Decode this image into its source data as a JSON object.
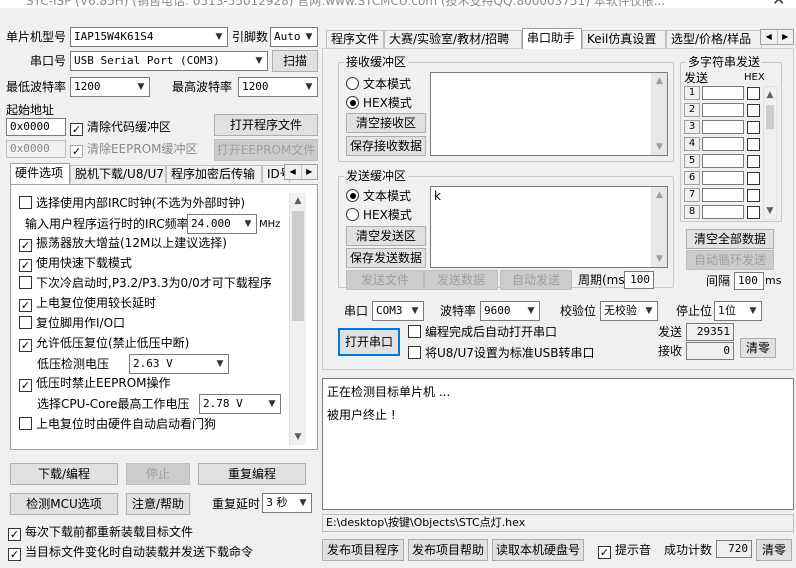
{
  "title_bar": {
    "text": "STC-ISP (V6.85H) (销售电话: 0513-55012928) 官网:www.STCMCU.com  (技术支持QQ:800003751) 本软件仅限..."
  },
  "left": {
    "mcu_model_label": "单片机型号",
    "mcu_model": "IAP15W4K61S4",
    "pins_label": "引脚数",
    "pins_value": "Auto",
    "port_label": "串口号",
    "port_value": "USB Serial Port (COM3)",
    "scan_button": "扫描",
    "min_baud_label": "最低波特率",
    "min_baud": "1200",
    "max_baud_label": "最高波特率",
    "max_baud": "1200",
    "start_addr_label": "起始地址",
    "addr1": "0x0000",
    "clear_code_label": "清除代码缓冲区",
    "open_program_button": "打开程序文件",
    "addr2": "0x0000",
    "clear_eeprom_label": "清除EEPROM缓冲区",
    "open_eeprom_button": "打开EEPROM文件",
    "tabs": [
      "硬件选项",
      "脱机下载/U8/U7",
      "程序加密后传输",
      "ID号"
    ],
    "options": [
      {
        "label": "选择使用内部IRC时钟(不选为外部时钟)",
        "checked": false
      },
      {
        "label": "振荡器放大增益(12M以上建议选择)",
        "checked": true
      },
      {
        "label": "使用快速下载模式",
        "checked": true
      },
      {
        "label": "下次冷启动时,P3.2/P3.3为0/0才可下载程序",
        "checked": false
      },
      {
        "label": "上电复位使用较长延时",
        "checked": true
      },
      {
        "label": "复位脚用作I/O口",
        "checked": false
      },
      {
        "label": "允许低压复位(禁止低压中断)",
        "checked": true
      },
      {
        "label": "低压时禁止EEPROM操作",
        "checked": true
      },
      {
        "label": "上电复位时由硬件自动启动看门狗",
        "checked": false
      }
    ],
    "irc_freq_label": "输入用户程序运行时的IRC频率",
    "irc_freq": "24.000",
    "irc_unit": "MHz",
    "lv_label": "低压检测电压",
    "lv_value": "2.63 V",
    "cpu_core_label": "选择CPU-Core最高工作电压",
    "cpu_core_value": "2.78 V",
    "download_button": "下载/编程",
    "stop_button": "停止",
    "reprogram_button": "重复编程",
    "detect_button": "检测MCU选项",
    "help_button": "注意/帮助",
    "repeat_delay_label": "重复延时",
    "repeat_delay": "3 秒",
    "reload_label": "每次下载前都重新装载目标文件",
    "auto_send_label": "当目标文件变化时自动装载并发送下载命令"
  },
  "right": {
    "tabs": [
      "程序文件",
      "大赛/实验室/教材/招聘",
      "串口助手",
      "Keil仿真设置",
      "选型/价格/样品"
    ],
    "rx_group": "接收缓冲区",
    "text_mode": "文本模式",
    "hex_mode": "HEX模式",
    "clear_rx": "清空接收区",
    "save_rx": "保存接收数据",
    "tx_group": "发送缓冲区",
    "clear_tx": "清空发送区",
    "save_tx": "保存发送数据",
    "tx_content": "k",
    "send_file": "发送文件",
    "send_data": "发送数据",
    "auto_send": "自动发送",
    "period_label": "周期(ms)",
    "period": "100",
    "multi_group": "多字符串发送",
    "send_col": "发送",
    "hex_col": "HEX",
    "rows": [
      "1",
      "2",
      "3",
      "4",
      "5",
      "6",
      "7",
      "8"
    ],
    "clear_all": "清空全部数据",
    "auto_loop": "自动循环发送",
    "interval_label": "间隔",
    "interval": "100",
    "interval_unit": "ms",
    "com_label": "串口",
    "com_value": "COM3",
    "baud_label": "波特率",
    "baud_value": "9600",
    "parity_label": "校验位",
    "parity_value": "无校验",
    "stop_label": "停止位",
    "stop_value": "1位",
    "open_port": "打开串口",
    "open_after_label": "编程完成后自动打开串口",
    "usb_label": "将U8/U7设置为标准USB转串口",
    "send_count_label": "发送",
    "send_count": "29351",
    "recv_count_label": "接收",
    "recv_count": "0",
    "clear_count": "清零",
    "log": [
      "正在检测目标单片机 ...",
      "被用户终止 !"
    ],
    "path": "E:\\desktop\\按键\\Objects\\STC点灯.hex",
    "publish_program": "发布项目程序",
    "publish_help": "发布项目帮助",
    "read_disk": "读取本机硬盘号",
    "beep_label": "提示音",
    "success_label": "成功计数",
    "success_count": "720",
    "clear_success": "清零"
  }
}
